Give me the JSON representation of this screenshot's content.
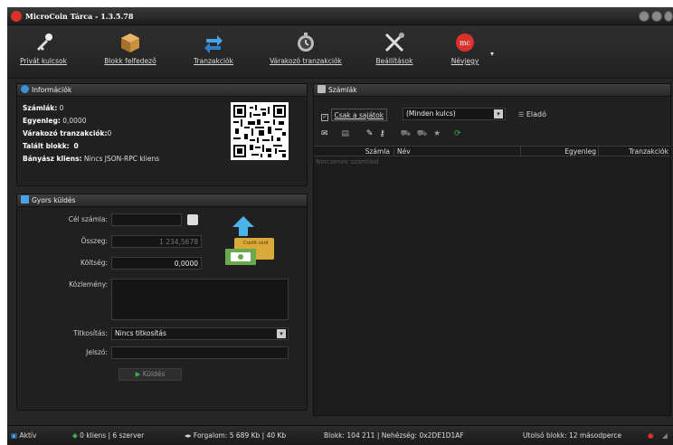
{
  "window": {
    "title": "MicroCoin Tárca - 1.3.5.78"
  },
  "toolbar": {
    "items": [
      {
        "label": "Privát kulcsok",
        "icon": "key-icon"
      },
      {
        "label": "Blokk felfedező",
        "icon": "box-icon"
      },
      {
        "label": "Tranzakciók",
        "icon": "transfer-icon"
      },
      {
        "label": "Várakozó tranzakciók",
        "icon": "clock-icon"
      },
      {
        "label": "Beállítások",
        "icon": "settings-tools-icon"
      },
      {
        "label": "Névjegy",
        "icon": "about-icon"
      }
    ]
  },
  "info": {
    "title": "Információk",
    "accounts_label": "Számlák:",
    "accounts_value": "0",
    "balance_label": "Egyenleg:",
    "balance_value": "0,0000",
    "pending_label": "Várakozó tranzakciók:",
    "pending_value": "0",
    "blocks_label": "Talált blokk:",
    "blocks_value": "0",
    "miner_label": "Bányász kliens:",
    "miner_value": "Nincs JSON-RPC kliens"
  },
  "quick_send": {
    "title": "Gyors küldés",
    "target_label": "Cél számla:",
    "target_value": "",
    "amount_label": "Összeg:",
    "amount_placeholder": "1 234,5678",
    "fee_label": "Költség:",
    "fee_value": "0,0000",
    "memo_label": "Közlemény:",
    "encryption_label": "Titkosítás:",
    "encryption_value": "Nincs titkosítás",
    "password_label": "Jelszó:",
    "send_label": "Küldés",
    "credit_card_text": "Credit card"
  },
  "accounts": {
    "title": "Számlák",
    "own_only_label": "Csak a sajátok",
    "key_filter_value": "(Minden kulcs)",
    "for_sale_label": "Eladó",
    "columns": [
      "Számla",
      "Név",
      "Egyenleg",
      "Tranzakciók"
    ],
    "empty_text": "Nincsenek számláid"
  },
  "status": {
    "state": "Aktív",
    "clients": "0 kliens | 6 szerver",
    "traffic": "Forgalom: 5 689 Kb | 40 Kb",
    "block_info": "Blokk: 104 211 | Nehézség: 0x2DE1D1AF",
    "last_block": "Utolsó blokk: 12 másodperce"
  },
  "colors": {
    "accent_green": "#3cb04a",
    "accent_blue": "#3a8fd8",
    "brand_red": "#d9322c"
  }
}
